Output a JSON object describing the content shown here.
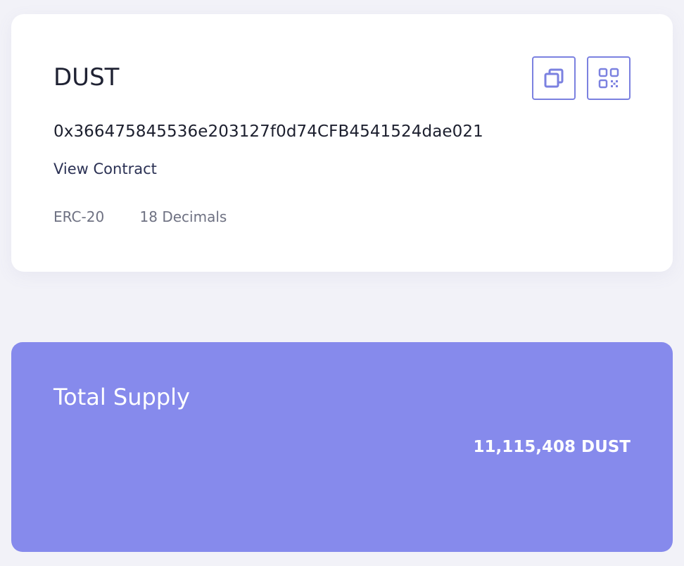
{
  "token": {
    "symbol": "DUST",
    "address": "0x366475845536e203127f0d74CFB4541524dae021",
    "view_contract_label": "View Contract",
    "standard": "ERC-20",
    "decimals_label": "18 Decimals",
    "actions": {
      "copy_icon": "copy-icon",
      "qr_icon": "qr-code-icon"
    }
  },
  "supply": {
    "title": "Total Supply",
    "value": "11,115,408 DUST"
  },
  "colors": {
    "accent": "#7b81e0",
    "supply_card_bg": "#868aec",
    "page_bg": "#f2f2f8",
    "card_bg": "#ffffff",
    "primary_text": "#1f2233",
    "link_text": "#2b3154",
    "muted_text": "#6e7182"
  }
}
